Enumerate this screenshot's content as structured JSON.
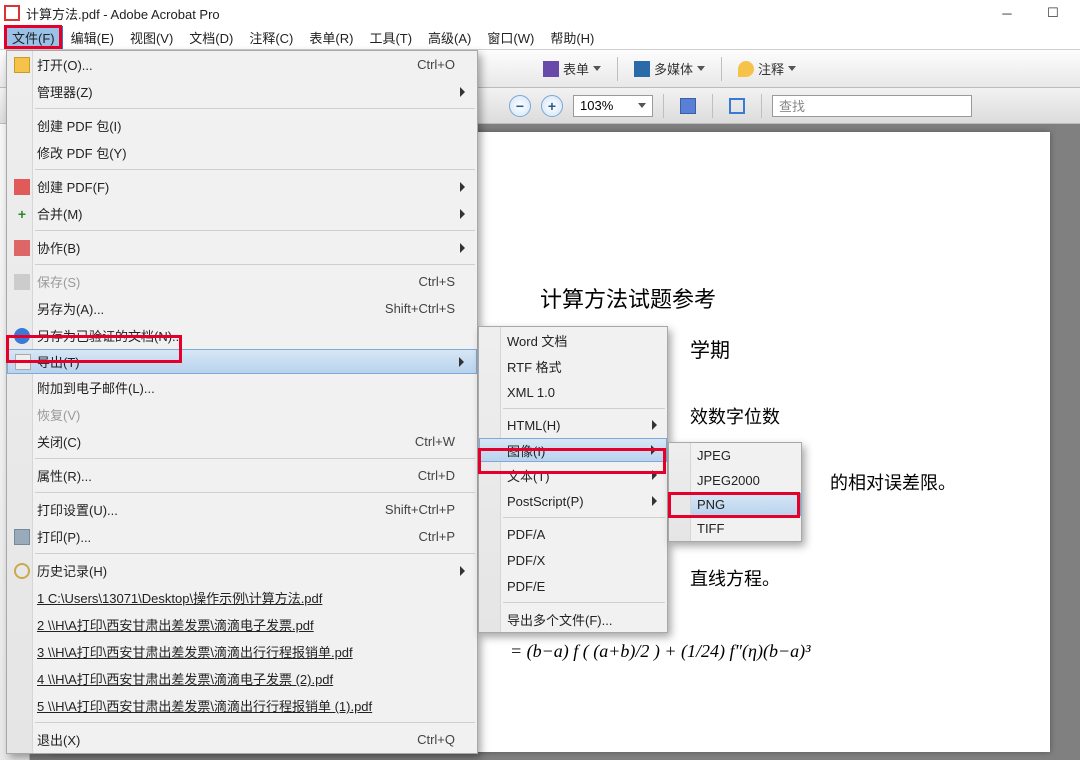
{
  "window": {
    "title": "计算方法.pdf - Adobe Acrobat Pro"
  },
  "menubar": {
    "items": [
      "文件(F)",
      "编辑(E)",
      "视图(V)",
      "文档(D)",
      "注释(C)",
      "表单(R)",
      "工具(T)",
      "高级(A)",
      "窗口(W)",
      "帮助(H)"
    ]
  },
  "toolbar": {
    "forms": "表单",
    "multimedia": "多媒体",
    "comment": "注释",
    "zoom": "103%",
    "search_placeholder": "查找"
  },
  "filemenu": {
    "open": "打开(O)...",
    "open_sc": "Ctrl+O",
    "organizer": "管理器(Z)",
    "create_pkg": "创建 PDF 包(I)",
    "modify_pkg": "修改 PDF 包(Y)",
    "create_pdf": "创建 PDF(F)",
    "combine": "合并(M)",
    "collab": "协作(B)",
    "save": "保存(S)",
    "save_sc": "Ctrl+S",
    "saveas": "另存为(A)...",
    "saveas_sc": "Shift+Ctrl+S",
    "savecert": "另存为已验证的文档(N)...",
    "export": "导出(T)",
    "attach": "附加到电子邮件(L)...",
    "revert": "恢复(V)",
    "close": "关闭(C)",
    "close_sc": "Ctrl+W",
    "props": "属性(R)...",
    "props_sc": "Ctrl+D",
    "printsetup": "打印设置(U)...",
    "printsetup_sc": "Shift+Ctrl+P",
    "print": "打印(P)...",
    "print_sc": "Ctrl+P",
    "history": "历史记录(H)",
    "recent1": "1 C:\\Users\\13071\\Desktop\\操作示例\\计算方法.pdf",
    "recent2": "2 \\\\H\\A打印\\西安甘肃出差发票\\滴滴电子发票.pdf",
    "recent3": "3 \\\\H\\A打印\\西安甘肃出差发票\\滴滴出行行程报销单.pdf",
    "recent4": "4 \\\\H\\A打印\\西安甘肃出差发票\\滴滴电子发票 (2).pdf",
    "recent5": "5 \\\\H\\A打印\\西安甘肃出差发票\\滴滴出行行程报销单 (1).pdf",
    "exit": "退出(X)",
    "exit_sc": "Ctrl+Q"
  },
  "export_submenu": {
    "word": "Word 文档",
    "rtf": "RTF 格式",
    "xml": "XML 1.0",
    "html": "HTML(H)",
    "image": "图像(I)",
    "text": "文本(T)",
    "ps": "PostScript(P)",
    "pdfa": "PDF/A",
    "pdfx": "PDF/X",
    "pdfe": "PDF/E",
    "multi": "导出多个文件(F)..."
  },
  "image_submenu": {
    "jpeg": "JPEG",
    "jpeg2000": "JPEG2000",
    "png": "PNG",
    "tiff": "TIFF"
  },
  "doc": {
    "title": "计算方法试题参考",
    "term": "学期",
    "line1": "效数字位数",
    "line2": "的相对误差限。",
    "line3": "直线方程。",
    "equation": "= (b−a) f ( (a+b)/2 ) + (1/24) f″(η)(b−a)³"
  }
}
